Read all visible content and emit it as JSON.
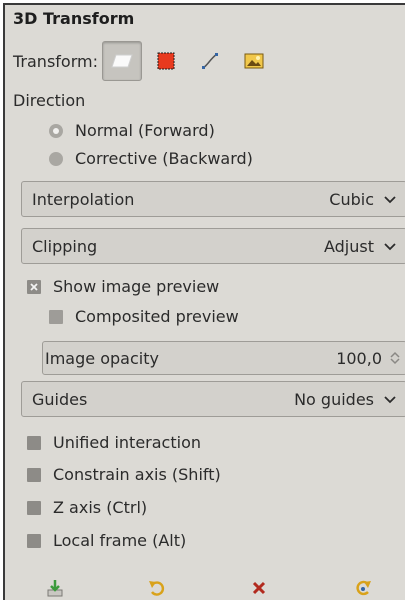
{
  "panel": {
    "title": "3D Transform",
    "transform_label": "Transform:",
    "transform_tools": [
      {
        "name": "transform-layer-icon",
        "active": true
      },
      {
        "name": "transform-selection-icon",
        "active": false
      },
      {
        "name": "transform-path-icon",
        "active": false
      },
      {
        "name": "transform-image-icon",
        "active": false
      }
    ],
    "direction": {
      "label": "Direction",
      "options": [
        {
          "label": "Normal (Forward)",
          "selected": true
        },
        {
          "label": "Corrective (Backward)",
          "selected": false
        }
      ]
    },
    "interpolation": {
      "label": "Interpolation",
      "value": "Cubic"
    },
    "clipping": {
      "label": "Clipping",
      "value": "Adjust"
    },
    "show_image_preview": {
      "label": "Show image preview",
      "checked": true
    },
    "composited_preview": {
      "label": "Composited preview",
      "checked": false
    },
    "image_opacity": {
      "label": "Image opacity",
      "value": "100,0"
    },
    "guides": {
      "label": "Guides",
      "value": "No guides"
    },
    "unified_interaction": {
      "label": "Unified interaction",
      "checked": false
    },
    "constrain_axis": {
      "label": "Constrain axis (Shift)",
      "checked": false
    },
    "z_axis": {
      "label": "Z axis (Ctrl)",
      "checked": false
    },
    "local_frame": {
      "label": "Local frame (Alt)",
      "checked": false
    }
  },
  "colors": {
    "panel_bg": "#dcdad5",
    "selection_red": "#e8391e",
    "reset_red": "#b22a1e",
    "save_green": "#4caf50",
    "accent_yellow": "#e0a800"
  },
  "bottom_icons": [
    "save-preset-icon",
    "restore-preset-icon",
    "delete-preset-icon",
    "reset-icon"
  ]
}
